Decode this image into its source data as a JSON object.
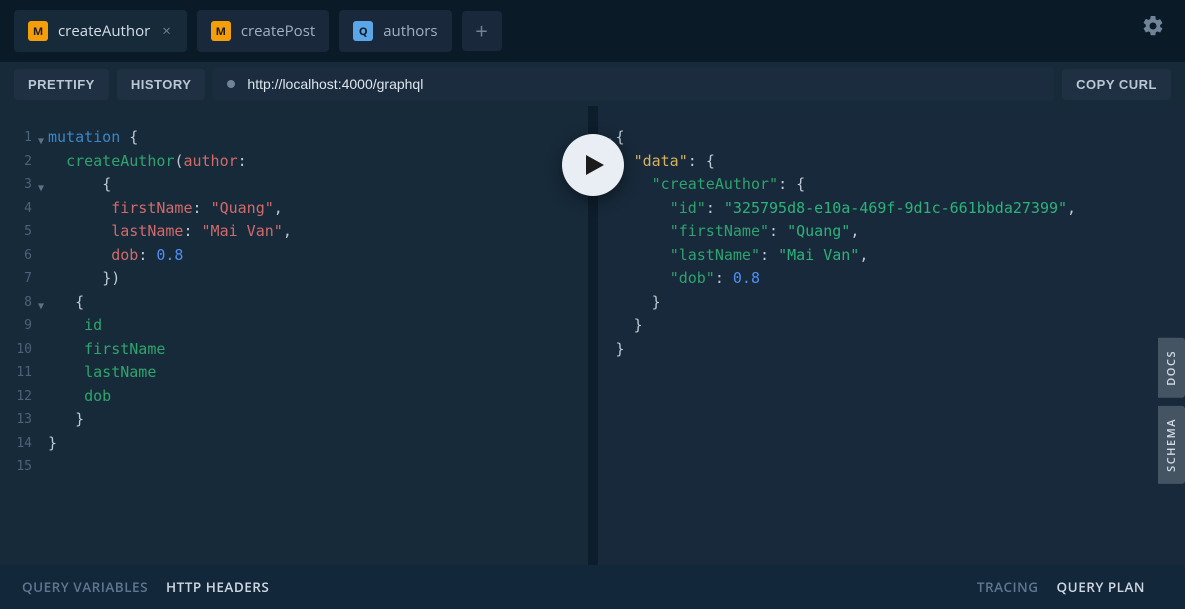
{
  "tabs": [
    {
      "badge": "M",
      "badgeType": "mutation",
      "label": "createAuthor",
      "active": true
    },
    {
      "badge": "M",
      "badgeType": "mutation",
      "label": "createPost",
      "active": false
    },
    {
      "badge": "Q",
      "badgeType": "query",
      "label": "authors",
      "active": false
    }
  ],
  "toolbar": {
    "prettify": "PRETTIFY",
    "history": "HISTORY",
    "url": "http://localhost:4000/graphql",
    "copycurl": "COPY CURL"
  },
  "editor": {
    "lines": [
      "1",
      "2",
      "3",
      "4",
      "5",
      "6",
      "7",
      "8",
      "9",
      "10",
      "11",
      "12",
      "13",
      "14",
      "15"
    ],
    "folds": {
      "1": true,
      "3": true,
      "8": true
    },
    "query": {
      "keyword": "mutation",
      "op": "createAuthor",
      "argname": "author",
      "fields_input": {
        "firstName": "\"Quang\"",
        "lastName": "\"Mai Van\"",
        "dob": "0.8"
      },
      "selection": [
        "id",
        "firstName",
        "lastName",
        "dob"
      ]
    }
  },
  "response": {
    "folds": 3,
    "data": {
      "root": "data",
      "opname": "createAuthor",
      "values": {
        "id": "\"325795d8-e10a-469f-9d1c-661bbda27399\"",
        "firstName": "\"Quang\"",
        "lastName": "\"Mai Van\"",
        "dob": "0.8"
      }
    }
  },
  "sidetabs": {
    "docs": "DOCS",
    "schema": "SCHEMA"
  },
  "footer": {
    "queryVariables": "QUERY VARIABLES",
    "httpHeaders": "HTTP HEADERS",
    "tracing": "TRACING",
    "queryPlan": "QUERY PLAN"
  }
}
